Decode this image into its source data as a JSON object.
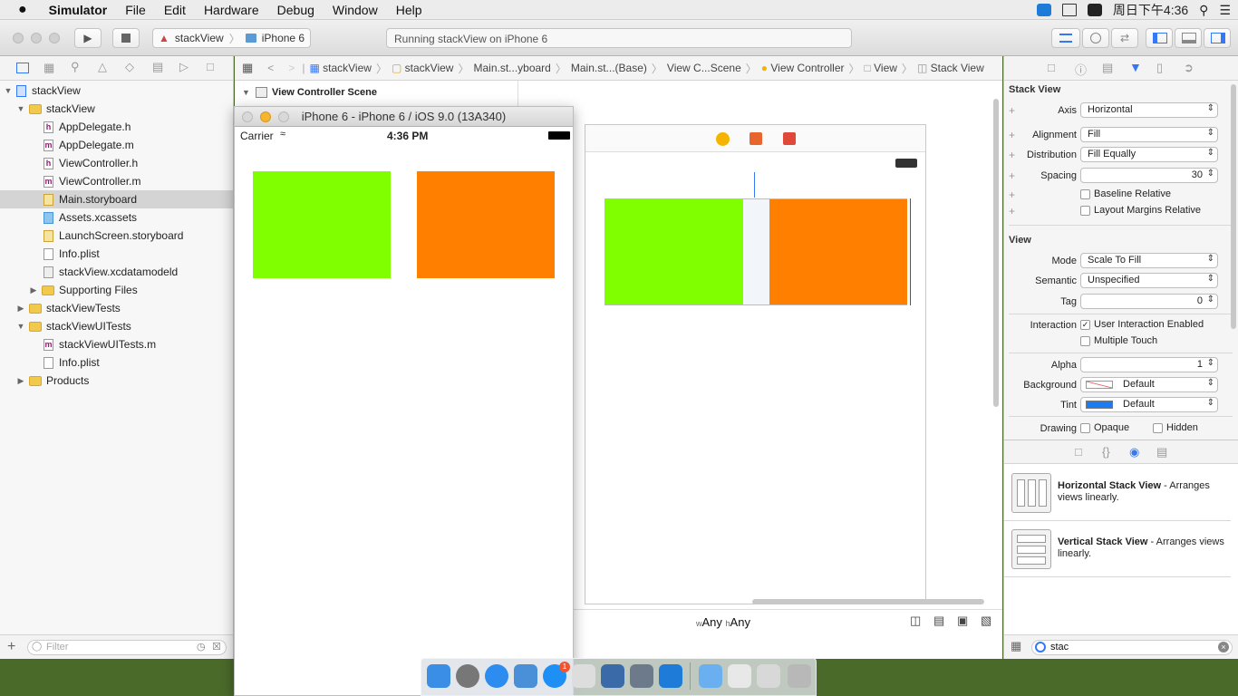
{
  "menubar": {
    "apple": "",
    "app_name": "Simulator",
    "items": [
      "File",
      "Edit",
      "Hardware",
      "Debug",
      "Window",
      "Help"
    ],
    "clock": "周日下午4:36"
  },
  "toolbar": {
    "scheme_target": "stackView",
    "scheme_device": "iPhone 6",
    "status": "Running stackView on iPhone 6"
  },
  "navigator": {
    "items": [
      {
        "label": "stackView",
        "kind": "project",
        "expanded": true
      },
      {
        "label": "stackView",
        "kind": "folder",
        "expanded": true
      },
      {
        "label": "AppDelegate.h",
        "kind": "h"
      },
      {
        "label": "AppDelegate.m",
        "kind": "m"
      },
      {
        "label": "ViewController.h",
        "kind": "h"
      },
      {
        "label": "ViewController.m",
        "kind": "m"
      },
      {
        "label": "Main.storyboard",
        "kind": "storyboard",
        "selected": true
      },
      {
        "label": "Assets.xcassets",
        "kind": "assets"
      },
      {
        "label": "LaunchScreen.storyboard",
        "kind": "storyboard"
      },
      {
        "label": "Info.plist",
        "kind": "plist"
      },
      {
        "label": "stackView.xcdatamodeld",
        "kind": "model"
      },
      {
        "label": "Supporting Files",
        "kind": "folder",
        "expanded": false
      },
      {
        "label": "stackViewTests",
        "kind": "folder",
        "expanded": false
      },
      {
        "label": "stackViewUITests",
        "kind": "folder",
        "expanded": true
      },
      {
        "label": "stackViewUITests.m",
        "kind": "m"
      },
      {
        "label": "Info.plist",
        "kind": "plist"
      },
      {
        "label": "Products",
        "kind": "folder",
        "expanded": false
      }
    ],
    "filter_placeholder": "Filter"
  },
  "jumpbar": {
    "crumbs": [
      "stackView",
      "stackView",
      "Main.st...yboard",
      "Main.st...(Base)",
      "View C...Scene",
      "View Controller",
      "View",
      "Stack View"
    ]
  },
  "outline": {
    "scene_title": "View Controller Scene"
  },
  "simulator": {
    "title": "iPhone 6 - iPhone 6 / iOS 9.0 (13A340)",
    "carrier": "Carrier",
    "time": "4:36 PM",
    "colors": {
      "left": "#80ff00",
      "right": "#ff8000"
    }
  },
  "canvas": {
    "size_class_w": "Any",
    "size_class_h": "Any",
    "w_prefix": "w",
    "h_prefix": "h"
  },
  "inspector": {
    "stack_view": {
      "title": "Stack View",
      "axis_label": "Axis",
      "axis": "Horizontal",
      "alignment_label": "Alignment",
      "alignment": "Fill",
      "distribution_label": "Distribution",
      "distribution": "Fill Equally",
      "spacing_label": "Spacing",
      "spacing": "30",
      "baseline_relative": "Baseline Relative",
      "layout_margins_relative": "Layout Margins Relative"
    },
    "view": {
      "title": "View",
      "mode_label": "Mode",
      "mode": "Scale To Fill",
      "semantic_label": "Semantic",
      "semantic": "Unspecified",
      "tag_label": "Tag",
      "tag": "0",
      "interaction_label": "Interaction",
      "user_interaction": "User Interaction Enabled",
      "multiple_touch": "Multiple Touch",
      "alpha_label": "Alpha",
      "alpha": "1",
      "background_label": "Background",
      "background": "Default",
      "tint_label": "Tint",
      "tint": "Default",
      "drawing_label": "Drawing",
      "opaque": "Opaque",
      "hidden": "Hidden"
    }
  },
  "library": {
    "items": [
      {
        "name": "Horizontal Stack View",
        "desc": " - Arranges views linearly."
      },
      {
        "name": "Vertical Stack View",
        "desc": " - Arranges views linearly."
      }
    ],
    "search_value": "stac"
  }
}
